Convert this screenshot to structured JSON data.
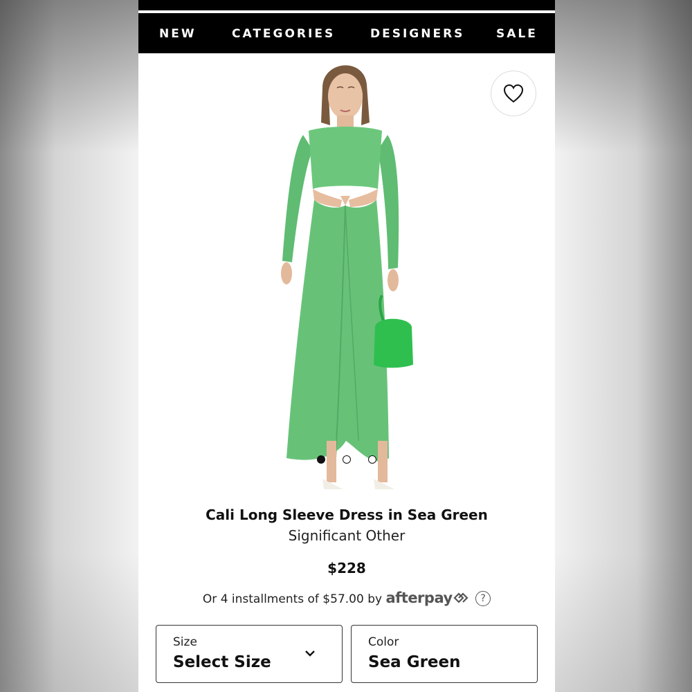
{
  "nav": {
    "items": [
      {
        "label": "NEW"
      },
      {
        "label": "CATEGORIES"
      },
      {
        "label": "DESIGNERS"
      },
      {
        "label": "SALE"
      }
    ]
  },
  "product": {
    "title": "Cali Long Sleeve Dress in Sea Green",
    "brand": "Significant Other",
    "price": "$228",
    "installments_prefix": "Or 4 installments of $57.00 by",
    "afterpay_logo": "afterpay",
    "help_glyph": "?",
    "dress_color": "#6cc77c",
    "bag_color": "#2fbf4f"
  },
  "gallery": {
    "image_count": 3,
    "active_index": 0
  },
  "options": {
    "size": {
      "label": "Size",
      "value": "Select Size"
    },
    "color": {
      "label": "Color",
      "value": "Sea Green"
    }
  },
  "icons": {
    "favorite": "heart-icon",
    "afterpay": "afterpay-arrows-icon",
    "help": "question-circle-icon",
    "dropdown": "chevron-down-icon"
  }
}
